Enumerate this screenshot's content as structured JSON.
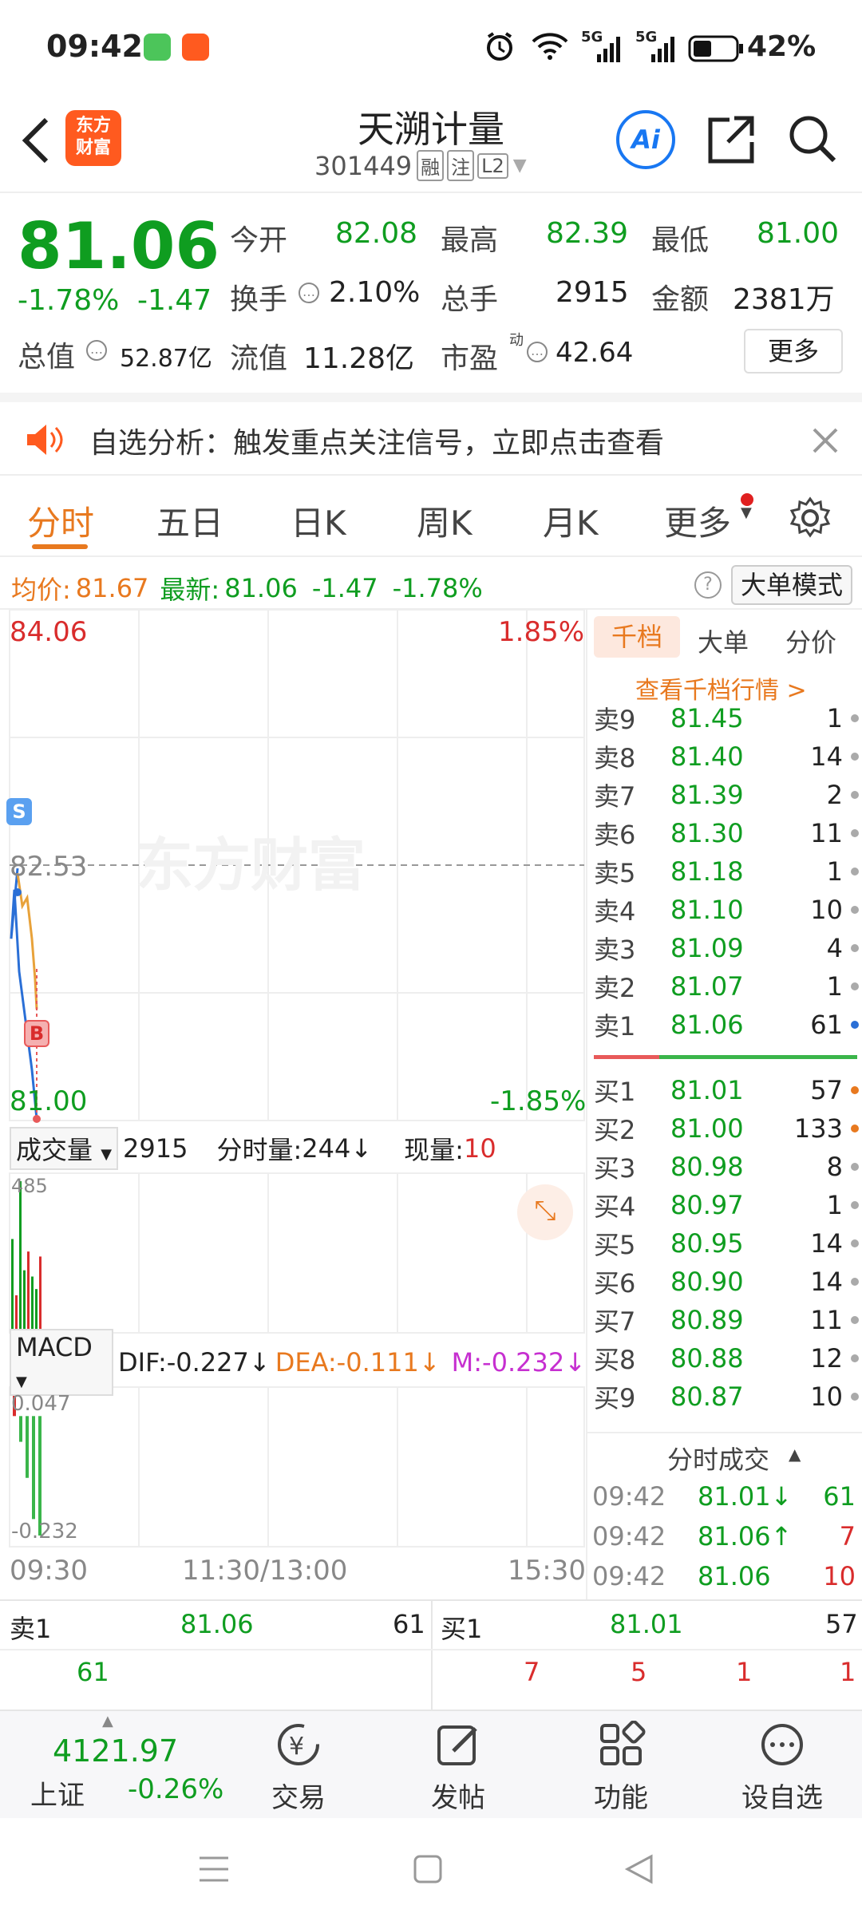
{
  "status": {
    "time": "09:42",
    "net1": "5G",
    "net2": "5G",
    "battery": "42%"
  },
  "header": {
    "logo_line1": "东方",
    "logo_line2": "财富",
    "title": "天溯计量",
    "code": "301449",
    "tag_rong": "融",
    "tag_zhu": "注",
    "tag_l2": "L2",
    "ai_label": "Ai"
  },
  "quote": {
    "price": "81.06",
    "pct": "-1.78%",
    "chg": "-1.47",
    "open_label": "今开",
    "open": "82.08",
    "high_label": "最高",
    "high": "82.39",
    "low_label": "最低",
    "low": "81.00",
    "turnover_label": "换手",
    "turnover": "2.10%",
    "volume_label": "总手",
    "volume": "2915",
    "amount_label": "金额",
    "amount": "2381万",
    "mktcap_label": "总值",
    "mktcap": "52.87亿",
    "float_label": "流值",
    "float": "11.28亿",
    "pe_label": "市盈",
    "pe_sup": "动",
    "pe": "42.64",
    "more_label": "更多"
  },
  "notice": {
    "text": "自选分析：触发重点关注信号，立即点击查看"
  },
  "tabs": [
    {
      "label": "分时"
    },
    {
      "label": "五日"
    },
    {
      "label": "日K"
    },
    {
      "label": "周K"
    },
    {
      "label": "月K"
    },
    {
      "label": "更多"
    }
  ],
  "avg": {
    "avg_label": "均价:",
    "avg_val": "81.67",
    "last_label": "最新:",
    "last_val": "81.06",
    "chg": "-1.47",
    "pct": "-1.78%",
    "mode_btn": "大单模式"
  },
  "chart": {
    "y_top": "84.06",
    "y_top_pct": "1.85%",
    "y_mid": "82.53",
    "y_bot": "81.00",
    "y_bot_pct": "-1.85%",
    "marker_s": "S",
    "marker_b": "B",
    "watermark": "东方财富",
    "vol_select": "成交量",
    "vol_total": "2915",
    "vol_per_label": "分时量:",
    "vol_per": "244↓",
    "vol_now_label": "现量:",
    "vol_now": "10",
    "vol_max": "485",
    "macd_select": "MACD",
    "dif": "DIF:-0.227↓",
    "dea": "DEA:-0.111↓",
    "m": "M:-0.232↓",
    "macd_top": "0.047",
    "macd_bot": "-0.232",
    "t_start": "09:30",
    "t_mid": "11:30/13:00",
    "t_end": "15:30"
  },
  "chart_data": {
    "type": "line",
    "series": [
      {
        "values": [
          82.53,
          82.1,
          82.4,
          81.9,
          81.3,
          81.0
        ]
      },
      {
        "values": [
          82.5,
          82.3,
          82.35,
          82.1,
          81.85,
          81.67
        ]
      }
    ],
    "ylim": [
      81.0,
      84.06
    ],
    "volume": [
      300,
      120,
      485,
      200,
      260,
      180,
      140,
      244
    ],
    "macd": [
      0.047,
      -0.05,
      -0.12,
      -0.2,
      -0.232
    ]
  },
  "book": {
    "tabs": [
      {
        "label": "千档"
      },
      {
        "label": "大单"
      },
      {
        "label": "分价"
      }
    ],
    "link": "查看千档行情 >",
    "asks": [
      {
        "label": "卖9",
        "price": "81.45",
        "vol": "1"
      },
      {
        "label": "卖8",
        "price": "81.40",
        "vol": "14"
      },
      {
        "label": "卖7",
        "price": "81.39",
        "vol": "2"
      },
      {
        "label": "卖6",
        "price": "81.30",
        "vol": "11"
      },
      {
        "label": "卖5",
        "price": "81.18",
        "vol": "1"
      },
      {
        "label": "卖4",
        "price": "81.10",
        "vol": "10"
      },
      {
        "label": "卖3",
        "price": "81.09",
        "vol": "4"
      },
      {
        "label": "卖2",
        "price": "81.07",
        "vol": "1"
      },
      {
        "label": "卖1",
        "price": "81.06",
        "vol": "61"
      }
    ],
    "bids": [
      {
        "label": "买1",
        "price": "81.01",
        "vol": "57"
      },
      {
        "label": "买2",
        "price": "81.00",
        "vol": "133"
      },
      {
        "label": "买3",
        "price": "80.98",
        "vol": "8"
      },
      {
        "label": "买4",
        "price": "80.97",
        "vol": "1"
      },
      {
        "label": "买5",
        "price": "80.95",
        "vol": "14"
      },
      {
        "label": "买6",
        "price": "80.90",
        "vol": "14"
      },
      {
        "label": "买7",
        "price": "80.89",
        "vol": "11"
      },
      {
        "label": "买8",
        "price": "80.88",
        "vol": "12"
      },
      {
        "label": "买9",
        "price": "80.87",
        "vol": "10"
      }
    ],
    "trades_title": "分时成交",
    "trades": [
      {
        "time": "09:42",
        "price": "81.01↓",
        "vol": "61"
      },
      {
        "time": "09:42",
        "price": "81.06↑",
        "vol": "7"
      },
      {
        "time": "09:42",
        "price": "81.06",
        "vol": "10"
      }
    ]
  },
  "bottomq": {
    "ask_label": "卖1",
    "ask_price": "81.06",
    "ask_vol": "61",
    "bid_label": "买1",
    "bid_price": "81.01",
    "bid_vol": "57",
    "ask_detail": "61",
    "bid_detail": [
      "7",
      "5",
      "1",
      "1"
    ]
  },
  "nav": {
    "index_val": "4121.97",
    "index_name": "上证",
    "index_pct": "-0.26%",
    "trade": "交易",
    "post": "发帖",
    "func": "功能",
    "fav": "设自选"
  },
  "colors": {
    "up": "#d92c2c",
    "down": "#0f9d20",
    "brand": "#ff5a1f",
    "accent": "#1877f2"
  }
}
